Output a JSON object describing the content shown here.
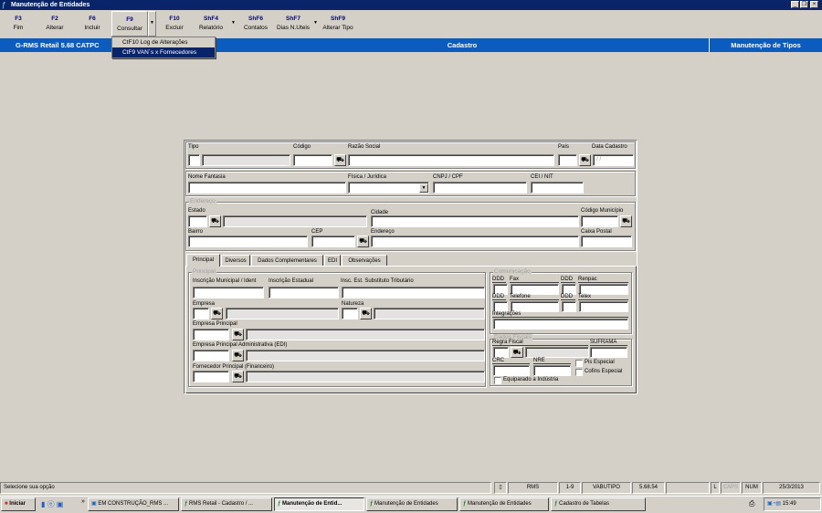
{
  "window": {
    "title": "Manutenção de Entidades"
  },
  "toolbar": [
    {
      "key": "F3",
      "label": "Fim"
    },
    {
      "key": "F2",
      "label": "Alterar"
    },
    {
      "key": "F6",
      "label": "Incluir"
    },
    {
      "key": "F9",
      "label": "Consultar"
    },
    {
      "key": "F10",
      "label": "Excluir"
    },
    {
      "key": "ShF4",
      "label": "Relatório"
    },
    {
      "key": "ShF6",
      "label": "Contatos"
    },
    {
      "key": "ShF7",
      "label": "Dias N.Uteis"
    },
    {
      "key": "ShF9",
      "label": "Alterar Tipo"
    }
  ],
  "dropdown_menu": [
    "CtF10 Log de Alterações",
    "CtF9  VAN´s x Fornecedores"
  ],
  "header": {
    "left": "G-RMS Retail 5.68 CATPC",
    "center": "Cadastro",
    "right": "Manutenção de Tipos"
  },
  "form": {
    "tipo": "Tipo",
    "codigo": "Código",
    "razao_social": "Razão Social",
    "pais": "País",
    "data_cadastro": "Data Cadastro",
    "data_cadastro_value": " / /",
    "nome_fantasia": "Nome Fantasia",
    "fisica_juridica": "Física / Jurídica",
    "cnpj_cpf": "CNPJ / CPF",
    "cei_nit": "CEI / NIT",
    "endereco_group": "Endereço",
    "estado": "Estado",
    "cidade": "Cidade",
    "codigo_municipio": "Código Município",
    "bairro": "Bairro",
    "cep": "CEP",
    "endereco": "Endereço",
    "caixa_postal": "Caixa Postal"
  },
  "tabs": [
    "Principal",
    "Diversos",
    "Dados Complementares",
    "EDI",
    "Observações"
  ],
  "principal": {
    "group": "Principal",
    "insc_municipal": "Inscrição Municipal / Ident",
    "insc_estadual": "Inscrição Estadual",
    "insc_substituto": "Insc. Est. Substituto Tributário",
    "empresa": "Empresa",
    "natureza": "Natureza",
    "empresa_principal": "Empresa Principal",
    "empresa_principal_adm": "Empresa Principal Administrativa (EDI)",
    "fornecedor_principal": "Fornecedor Principal (Financeiro)"
  },
  "comunicacao": {
    "group": "Comunicação",
    "ddd": "DDD",
    "fax": "Fax",
    "renpac": "Renpac",
    "telefone": "Telefone",
    "telex": "Telex",
    "integracoes": "Integrações"
  },
  "fiscais": {
    "group": "Dados Fiscais",
    "regra_fiscal": "Regra Fiscal",
    "suframa": "SUFRAMA",
    "crc": "CRC",
    "nre": "NRE",
    "pis": "Pis Especial",
    "cofins": "Cofins Especial",
    "equiparado": "Equiparado a Indústria"
  },
  "statusbar": {
    "message": "Selecione sua opção",
    "panels": [
      "RMS",
      "1-9",
      "VABUTIPO",
      "5.68.54",
      "",
      "L",
      "CAPS",
      "NUM",
      "25/3/2013"
    ]
  },
  "taskbar": {
    "start": "Iniciar",
    "more": "»",
    "items": [
      "EM CONSTRUÇÃO_RMS ...",
      "RMS Retail - Cadastro / ...",
      "Manutenção de Entid...",
      "Manutenção de Entidades",
      "Manutenção de Entidades",
      "Cadastro de Tabelas"
    ],
    "clock": "15:49"
  }
}
